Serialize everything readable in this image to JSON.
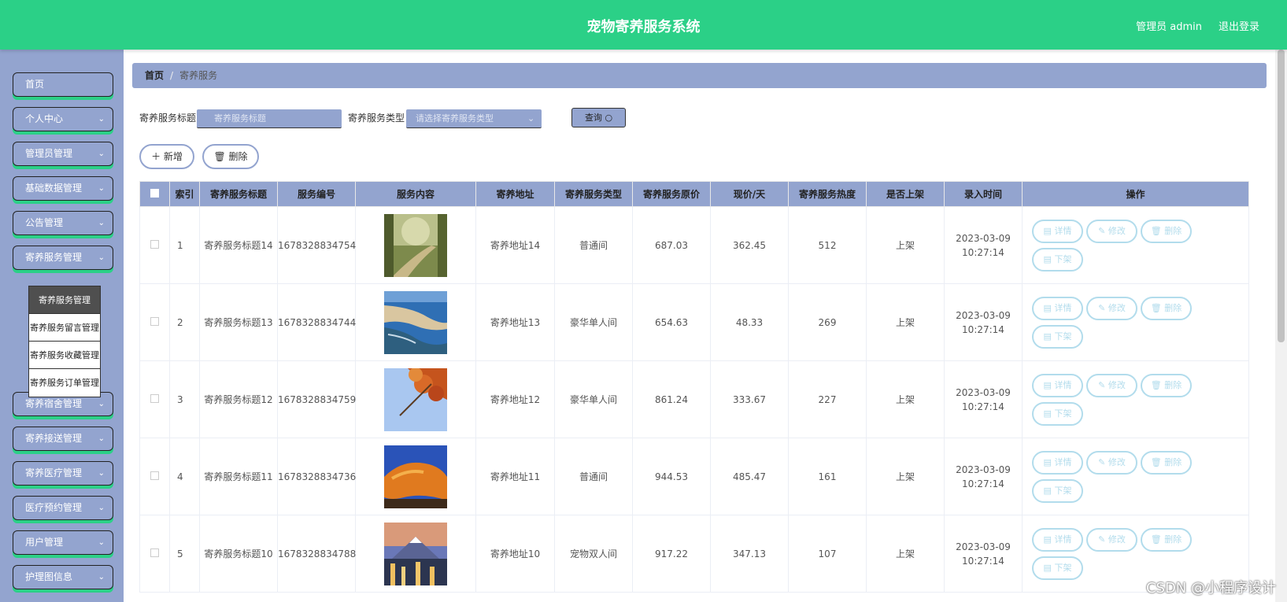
{
  "header": {
    "title": "宠物寄养服务系统",
    "user": "管理员 admin",
    "logout": "退出登录"
  },
  "sidebar": {
    "items": [
      {
        "label": "首页",
        "has_chevron": false
      },
      {
        "label": "个人中心",
        "has_chevron": true
      },
      {
        "label": "管理员管理",
        "has_chevron": true
      },
      {
        "label": "基础数据管理",
        "has_chevron": true
      },
      {
        "label": "公告管理",
        "has_chevron": true
      },
      {
        "label": "寄养服务管理",
        "has_chevron": true
      },
      {
        "label": "寄养宿舍管理",
        "has_chevron": true
      },
      {
        "label": "寄养接送管理",
        "has_chevron": true
      },
      {
        "label": "寄养医疗管理",
        "has_chevron": true
      },
      {
        "label": "医疗预约管理",
        "has_chevron": true
      },
      {
        "label": "用户管理",
        "has_chevron": true
      },
      {
        "label": "护理图信息",
        "has_chevron": true
      }
    ],
    "submenu": [
      "寄养服务管理",
      "寄养服务留言管理",
      "寄养服务收藏管理",
      "寄养服务订单管理"
    ],
    "submenu_active": 0
  },
  "breadcrumb": {
    "home": "首页",
    "current": "寄养服务"
  },
  "search": {
    "title_label": "寄养服务标题",
    "title_placeholder": "寄养服务标题",
    "type_label": "寄养服务类型",
    "type_placeholder": "请选择寄养服务类型",
    "query_label": "查询"
  },
  "actions": {
    "add_label": "新增",
    "delete_label": "删除"
  },
  "table": {
    "headers": [
      "索引",
      "寄养服务标题",
      "服务编号",
      "服务内容",
      "寄养地址",
      "寄养服务类型",
      "寄养服务原价",
      "现价/天",
      "寄养服务热度",
      "是否上架",
      "录入时间",
      "操作"
    ],
    "op_labels": {
      "detail": "详情",
      "edit": "修改",
      "delete": "删除",
      "offline": "下架"
    },
    "rows": [
      {
        "index": "1",
        "title": "寄养服务标题14",
        "code": "1678328834754",
        "image": "forest-path",
        "address": "寄养地址14",
        "type": "普通间",
        "orig_price": "687.03",
        "price": "362.45",
        "heat": "512",
        "status": "上架",
        "time": "2023-03-09 10:27:14"
      },
      {
        "index": "2",
        "title": "寄养服务标题13",
        "code": "1678328834744",
        "image": "coastline",
        "address": "寄养地址13",
        "type": "豪华单人间",
        "orig_price": "654.63",
        "price": "48.33",
        "heat": "269",
        "status": "上架",
        "time": "2023-03-09 10:27:14"
      },
      {
        "index": "3",
        "title": "寄养服务标题12",
        "code": "1678328834759",
        "image": "autumn-leaves",
        "address": "寄养地址12",
        "type": "豪华单人间",
        "orig_price": "861.24",
        "price": "333.67",
        "heat": "227",
        "status": "上架",
        "time": "2023-03-09 10:27:14"
      },
      {
        "index": "4",
        "title": "寄养服务标题11",
        "code": "1678328834736",
        "image": "orange-rock",
        "address": "寄养地址11",
        "type": "普通间",
        "orig_price": "944.53",
        "price": "485.47",
        "heat": "161",
        "status": "上架",
        "time": "2023-03-09 10:27:14"
      },
      {
        "index": "5",
        "title": "寄养服务标题10",
        "code": "1678328834788",
        "image": "mountain-city",
        "address": "寄养地址10",
        "type": "宠物双人间",
        "orig_price": "917.22",
        "price": "347.13",
        "heat": "107",
        "status": "上架",
        "time": "2023-03-09 10:27:14"
      }
    ]
  },
  "watermark": "CSDN @小程序设计",
  "colors": {
    "header": "#2bd087",
    "accent": "#93a4cf",
    "op_button": "#b2dcec"
  }
}
